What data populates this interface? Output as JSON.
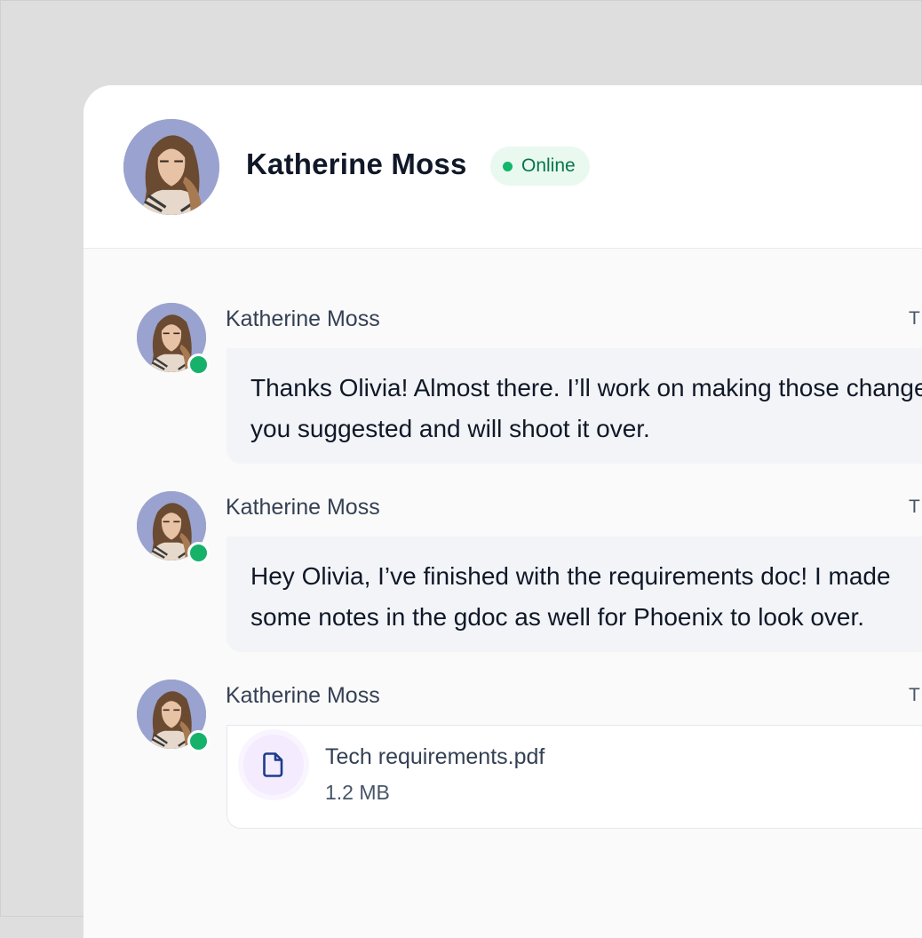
{
  "header": {
    "name": "Katherine Moss",
    "status": "Online"
  },
  "messages": [
    {
      "sender": "Katherine Moss",
      "time": "T",
      "text_lines": [
        "Thanks Olivia! Almost there. I’ll work on making those changes",
        "you suggested and will shoot it over."
      ]
    },
    {
      "sender": "Katherine Moss",
      "time": "T",
      "text_lines": [
        "Hey Olivia, I’ve finished with the requirements doc! I made",
        "some notes in the gdoc as well for Phoenix to look over."
      ]
    },
    {
      "sender": "Katherine Moss",
      "time": "T",
      "file": {
        "name": "Tech requirements.pdf",
        "size": "1.2 MB",
        "icon": "file-icon"
      }
    }
  ],
  "colors": {
    "online_dot": "#12b76a",
    "online_badge_bg": "#e9f9ef",
    "online_text": "#067647",
    "bubble_bg": "#f2f4f7",
    "file_icon": "#1d3c8a"
  }
}
